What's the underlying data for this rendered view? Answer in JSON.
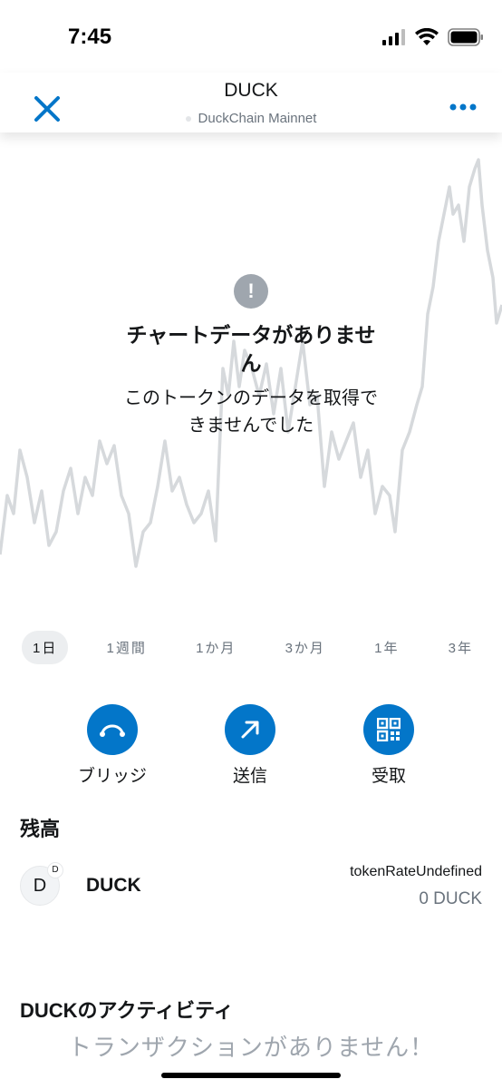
{
  "status_bar": {
    "time": "7:45"
  },
  "header": {
    "title": "DUCK",
    "network": "DuckChain Mainnet"
  },
  "chart": {
    "empty_title": "チャートデータがありません",
    "empty_description": "このトークンのデータを取得できませんでした",
    "line_color": "#d6d9dc"
  },
  "timeframes": [
    "1日",
    "1週間",
    "1か月",
    "3か月",
    "1年",
    "3年"
  ],
  "selected_timeframe": "1日",
  "actions": {
    "bridge": "ブリッジ",
    "send": "送信",
    "receive": "受取"
  },
  "balance": {
    "heading": "残高",
    "token_symbol_avatar": "D",
    "token_badge": "D",
    "token_name": "DUCK",
    "rate": "tokenRateUndefined",
    "amount": "0 DUCK"
  },
  "activity": {
    "heading": "DUCKのアクティビティ",
    "empty": "トランザクションがありません！"
  },
  "colors": {
    "accent": "#0376c9",
    "text_muted": "#6a737d"
  }
}
